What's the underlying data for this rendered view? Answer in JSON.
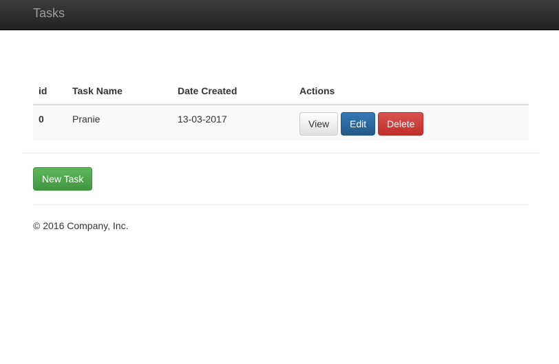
{
  "navbar": {
    "brand": "Tasks"
  },
  "table": {
    "headers": {
      "id": "id",
      "name": "Task Name",
      "date": "Date Created",
      "actions": "Actions"
    },
    "rows": [
      {
        "id": "0",
        "name": "Pranie",
        "date": "13-03-2017",
        "view_label": "View",
        "edit_label": "Edit",
        "delete_label": "Delete"
      }
    ]
  },
  "new_task_label": "New Task",
  "footer": {
    "text": "© 2016 Company, Inc."
  },
  "colors": {
    "navbar": "#222222",
    "primary": "#337ab7",
    "danger": "#d9534f",
    "success": "#5cb85c"
  }
}
